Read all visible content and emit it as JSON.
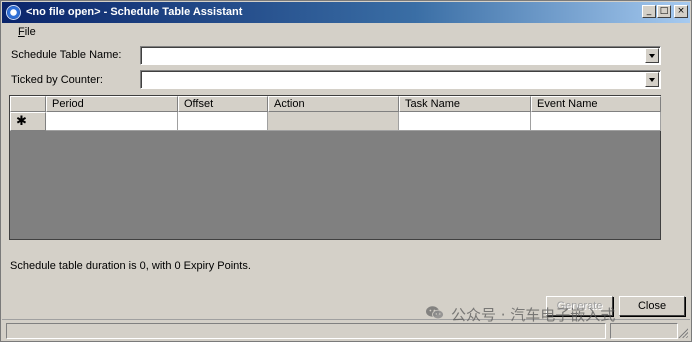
{
  "window": {
    "title": "<no file open> - Schedule Table Assistant",
    "controls": {
      "minimize": "_",
      "maximize": "□",
      "close": "×"
    }
  },
  "menu": {
    "file_accel": "F",
    "file_rest": "ile"
  },
  "form": {
    "schedule_table_name_label": "Schedule Table Name:",
    "schedule_table_name_value": "",
    "ticked_by_counter_label": "Ticked by Counter:",
    "ticked_by_counter_value": ""
  },
  "grid": {
    "columns": [
      "Period",
      "Offset",
      "Action",
      "Task Name",
      "Event Name"
    ],
    "new_row_marker": "✱"
  },
  "status_text": "Schedule table duration is 0, with 0 Expiry Points.",
  "buttons": {
    "generate": "Generate",
    "close": "Close"
  },
  "watermark": {
    "text": "公众号 · 汽车电子嵌入式",
    "icon": "wechat-icon"
  }
}
